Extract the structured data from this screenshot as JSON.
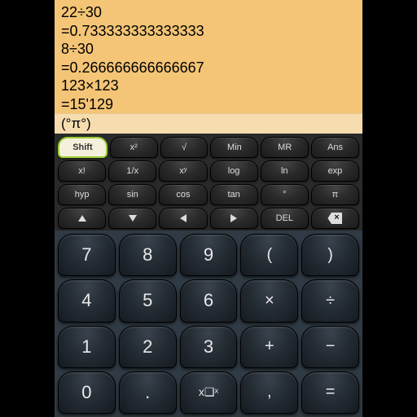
{
  "display": {
    "history": [
      "22÷30",
      "=0.733333333333333",
      "8÷30",
      "=0.266666666666667",
      "123×123",
      "=15'129"
    ],
    "input": "(°π°)"
  },
  "fn": {
    "r1": [
      "Shift",
      "x²",
      "√",
      "Min",
      "MR",
      "Ans"
    ],
    "r2": [
      "x!",
      "1/x",
      "xʸ",
      "log",
      "ln",
      "exp"
    ],
    "r3": [
      "hyp",
      "sin",
      "cos",
      "tan",
      "°",
      "π"
    ],
    "r4_del": "DEL"
  },
  "num": {
    "r1": [
      "7",
      "8",
      "9",
      "(",
      ")"
    ],
    "r2": [
      "4",
      "5",
      "6",
      "×",
      "÷"
    ],
    "r3": [
      "1",
      "2",
      "3",
      "+",
      "−"
    ],
    "r4": [
      "0",
      ".",
      "x❑ˣ",
      ",",
      "="
    ]
  }
}
